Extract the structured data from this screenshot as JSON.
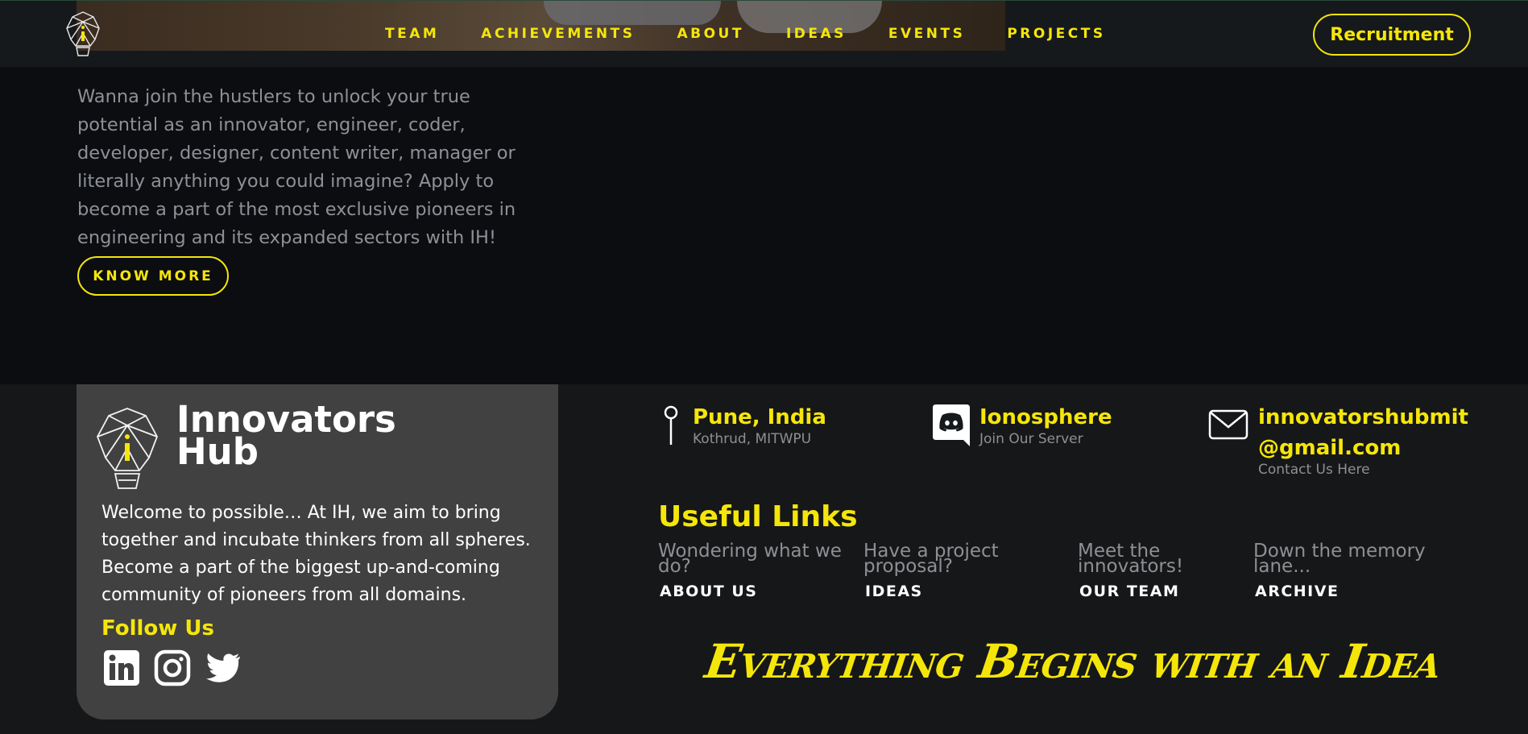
{
  "nav": {
    "links": [
      "TEAM",
      "ACHIEVEMENTS",
      "ABOUT",
      "IDEAS",
      "EVENTS",
      "PROJECTS"
    ],
    "cta": "Recruitment"
  },
  "intro": {
    "text": "Wanna join the hustlers to unlock your true potential as an innovator, engineer, coder, developer, designer, content writer, manager or literally anything you could imagine? Apply to become a part of the most exclusive pioneers in engineering and its expanded sectors with IH!",
    "button": "KNOW MORE"
  },
  "footer": {
    "brand_line1": "Innovators",
    "brand_line2": "Hub",
    "description": "Welcome to possible… At IH, we aim to bring together and incubate thinkers from all spheres. Become a part of the biggest up-and-coming community of pioneers from all domains.",
    "follow_label": "Follow Us",
    "socials": [
      "linkedin-icon",
      "instagram-icon",
      "twitter-icon"
    ],
    "location": {
      "title": "Pune, India",
      "sub": "Kothrud, MITWPU"
    },
    "discord": {
      "title": "Ionosphere",
      "sub": "Join Our Server"
    },
    "email": {
      "title_line1": "innovatorshubmit",
      "title_line2": "@gmail.com",
      "sub": "Contact Us Here"
    },
    "useful_title": "Useful Links",
    "useful_links": [
      {
        "question": "Wondering what we do?",
        "link": "ABOUT US"
      },
      {
        "question": "Have a project proposal?",
        "link": "IDEAS"
      },
      {
        "question": "Meet the innovators!",
        "link": "OUR TEAM"
      },
      {
        "question": "Down the memory lane...",
        "link": "ARCHIVE"
      }
    ],
    "tagline": "Everything Begins with an Idea"
  },
  "colors": {
    "accent": "#f5e60a",
    "background": "#0b0d11",
    "footer": "#161718",
    "card": "#414141"
  }
}
